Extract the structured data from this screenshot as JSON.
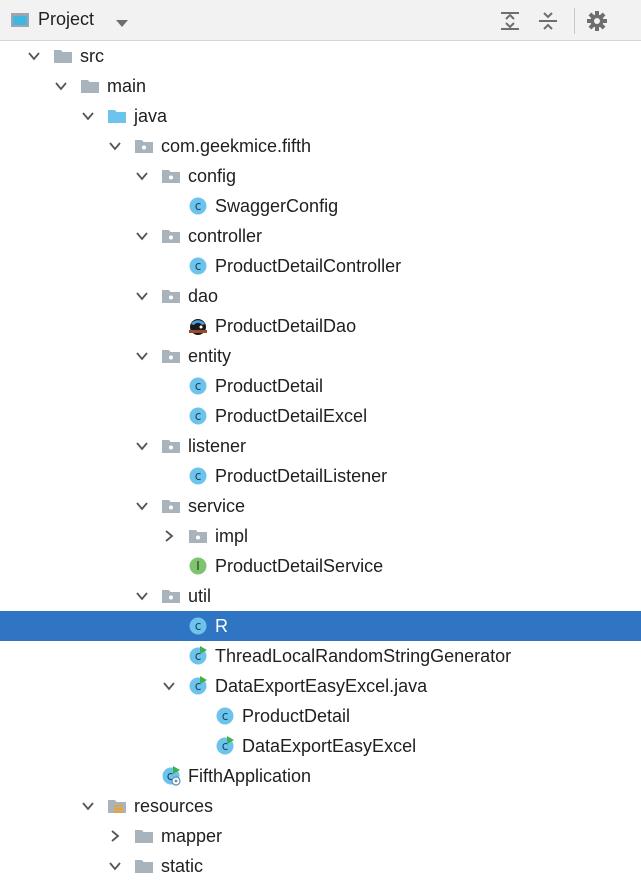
{
  "header": {
    "title": "Project"
  },
  "tree": [
    {
      "label": "src",
      "depth": 0,
      "expand": "open",
      "icon": "folder"
    },
    {
      "label": "main",
      "depth": 1,
      "expand": "open",
      "icon": "folder"
    },
    {
      "label": "java",
      "depth": 2,
      "expand": "open",
      "icon": "source-folder"
    },
    {
      "label": "com.geekmice.fifth",
      "depth": 3,
      "expand": "open",
      "icon": "package"
    },
    {
      "label": "config",
      "depth": 4,
      "expand": "open",
      "icon": "package"
    },
    {
      "label": "SwaggerConfig",
      "depth": 5,
      "expand": "none",
      "icon": "class"
    },
    {
      "label": "controller",
      "depth": 4,
      "expand": "open",
      "icon": "package"
    },
    {
      "label": "ProductDetailController",
      "depth": 5,
      "expand": "none",
      "icon": "class"
    },
    {
      "label": "dao",
      "depth": 4,
      "expand": "open",
      "icon": "package"
    },
    {
      "label": "ProductDetailDao",
      "depth": 5,
      "expand": "none",
      "icon": "mybatis"
    },
    {
      "label": "entity",
      "depth": 4,
      "expand": "open",
      "icon": "package"
    },
    {
      "label": "ProductDetail",
      "depth": 5,
      "expand": "none",
      "icon": "class"
    },
    {
      "label": "ProductDetailExcel",
      "depth": 5,
      "expand": "none",
      "icon": "class"
    },
    {
      "label": "listener",
      "depth": 4,
      "expand": "open",
      "icon": "package"
    },
    {
      "label": "ProductDetailListener",
      "depth": 5,
      "expand": "none",
      "icon": "class"
    },
    {
      "label": "service",
      "depth": 4,
      "expand": "open",
      "icon": "package"
    },
    {
      "label": "impl",
      "depth": 5,
      "expand": "closed",
      "icon": "package"
    },
    {
      "label": "ProductDetailService",
      "depth": 5,
      "expand": "none",
      "icon": "interface"
    },
    {
      "label": "util",
      "depth": 4,
      "expand": "open",
      "icon": "package"
    },
    {
      "label": "R",
      "depth": 5,
      "expand": "none",
      "icon": "class",
      "selected": true
    },
    {
      "label": "ThreadLocalRandomStringGenerator",
      "depth": 5,
      "expand": "none",
      "icon": "class-main"
    },
    {
      "label": "DataExportEasyExcel.java",
      "depth": 5,
      "expand": "open",
      "icon": "class-main"
    },
    {
      "label": "ProductDetail",
      "depth": 6,
      "expand": "none",
      "icon": "class"
    },
    {
      "label": "DataExportEasyExcel",
      "depth": 6,
      "expand": "none",
      "icon": "class-main"
    },
    {
      "label": "FifthApplication",
      "depth": 4,
      "expand": "none",
      "icon": "spring-app"
    },
    {
      "label": "resources",
      "depth": 2,
      "expand": "open",
      "icon": "resources-folder"
    },
    {
      "label": "mapper",
      "depth": 3,
      "expand": "closed",
      "icon": "folder"
    },
    {
      "label": "static",
      "depth": 3,
      "expand": "open",
      "icon": "folder"
    }
  ]
}
